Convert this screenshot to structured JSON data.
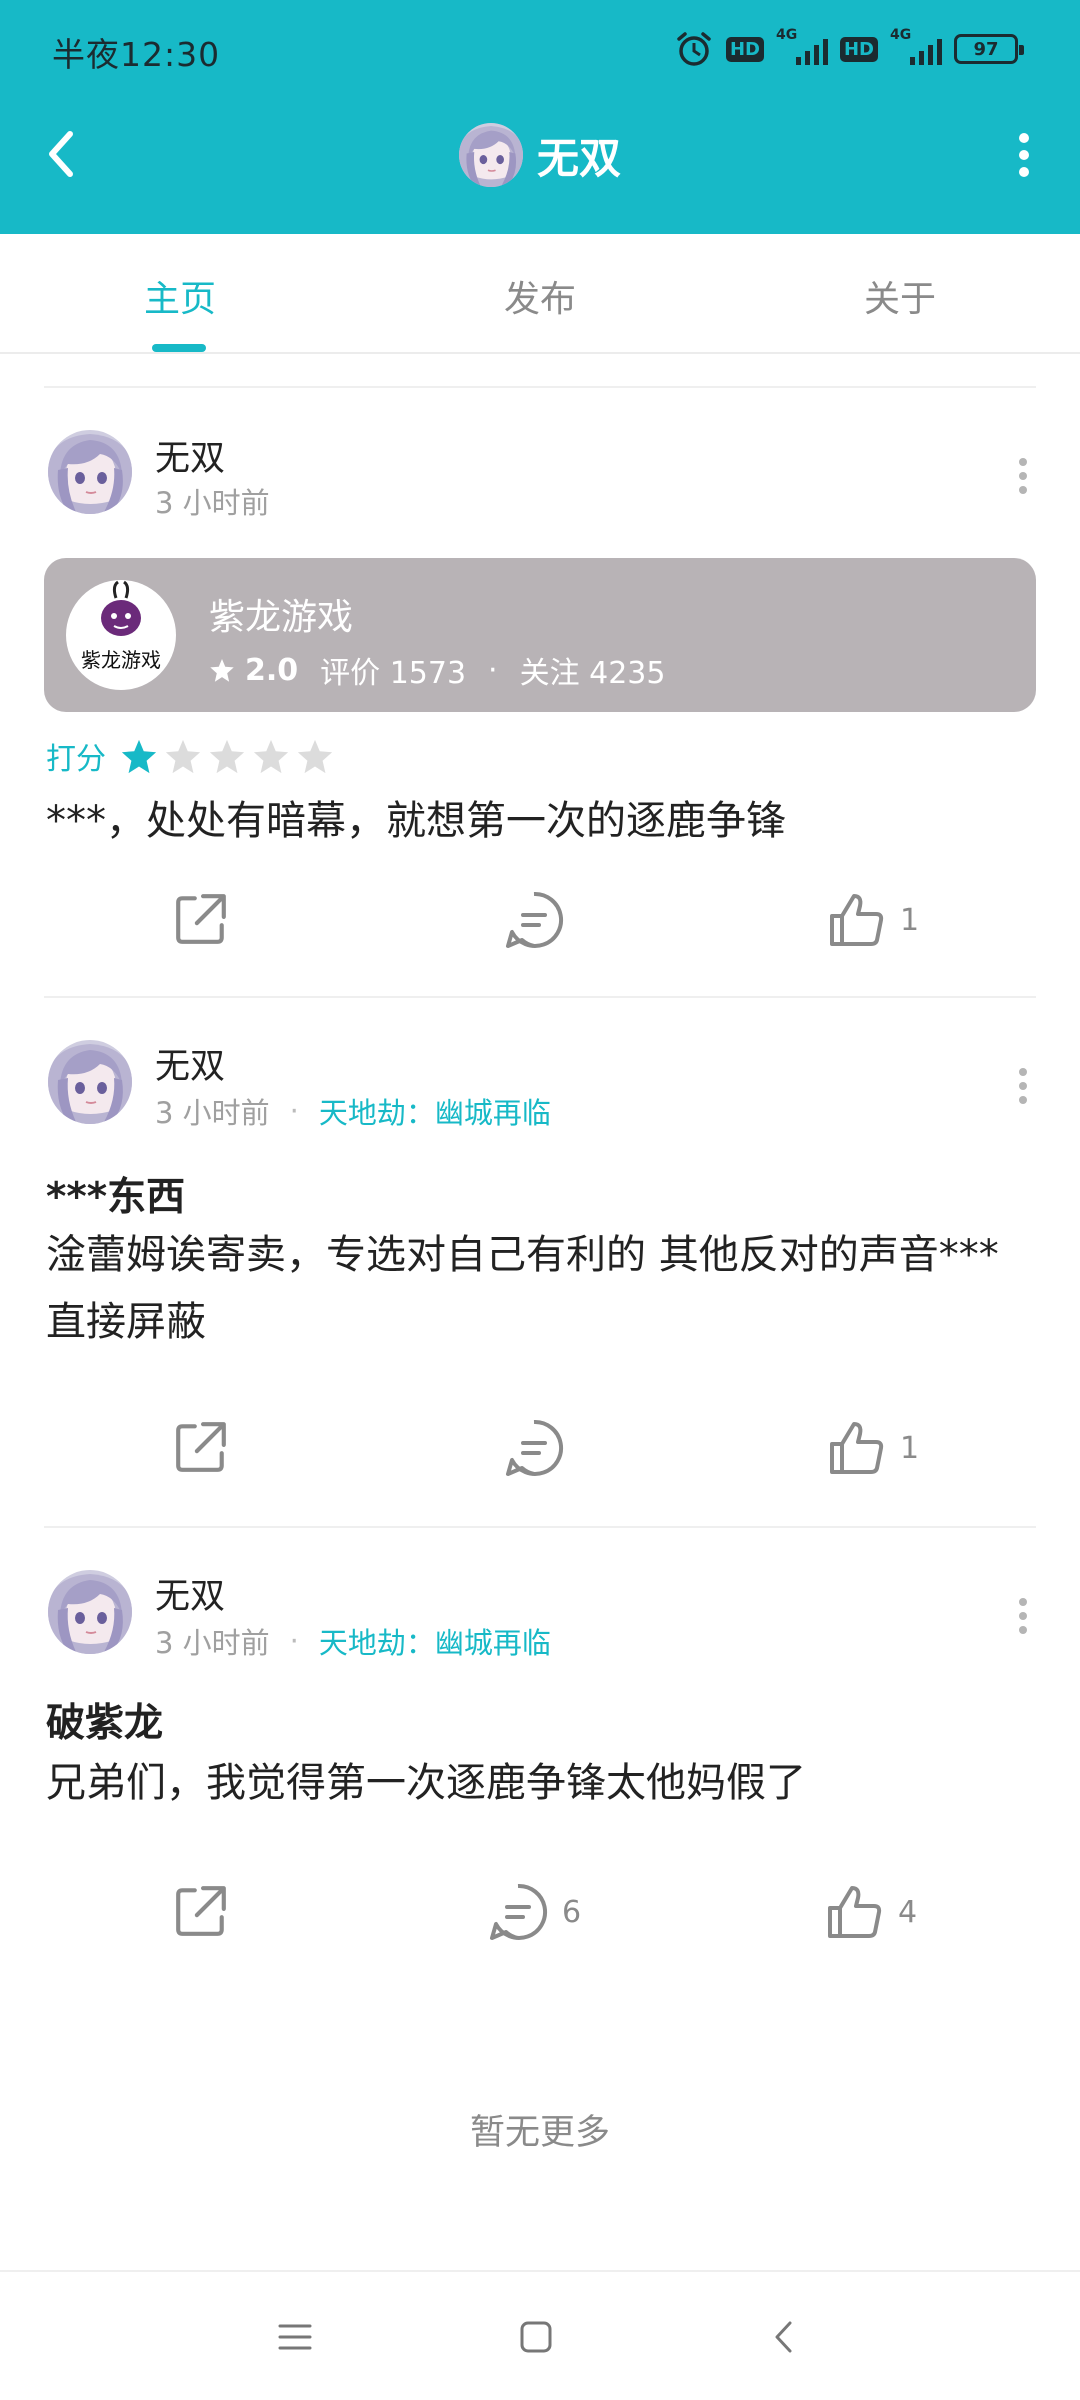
{
  "status_bar": {
    "time": "半夜12:30",
    "network_left": "4G",
    "network_right": "4G",
    "hd_left": "HD",
    "hd_right": "HD",
    "battery": "97",
    "icons": [
      "alarm-icon",
      "hd-icon",
      "signal-icon",
      "hd-icon",
      "signal-icon",
      "battery-icon"
    ]
  },
  "header": {
    "title": "无双",
    "back_icon": "chevron-left-icon",
    "more_icon": "more-vertical-icon",
    "bg_color": "#17b9c7"
  },
  "tabs": [
    {
      "label": "主页",
      "active": true
    },
    {
      "label": "发布",
      "active": false
    },
    {
      "label": "关于",
      "active": false
    }
  ],
  "posts": [
    {
      "author": "无双",
      "time": "3 小时前",
      "game_card": {
        "logo_text": "紫龙游戏",
        "name": "紫龙游戏",
        "score": "2.0",
        "reviews_label": "评价 1573",
        "followers_label": "关注 4235",
        "separator": "·"
      },
      "rating_label": "打分",
      "rating_stars": 1,
      "rating_max": 5,
      "body": "***，处处有暗幕，就想第一次的逐鹿争锋",
      "comments": "",
      "likes": "1"
    },
    {
      "author": "无双",
      "time": "3 小时前",
      "dot": "·",
      "game_link": "天地劫：幽城再临",
      "title": "***东西",
      "body": "淦蕾姆诶寄卖，专选对自己有利的 其他反对的声音***直接屏蔽",
      "comments": "",
      "likes": "1"
    },
    {
      "author": "无双",
      "time": "3 小时前",
      "dot": "·",
      "game_link": "天地劫：幽城再临",
      "title": "破紫龙",
      "body": "兄弟们，我觉得第一次逐鹿争锋太他妈假了",
      "comments": "6",
      "likes": "4"
    }
  ],
  "footer_text": "暂无更多",
  "nav_icons": [
    "menu-icon",
    "home-square-icon",
    "back-icon"
  ],
  "colors": {
    "accent": "#17b9c7",
    "card": "#b8b3b6",
    "star_off": "#dcdcdc"
  }
}
